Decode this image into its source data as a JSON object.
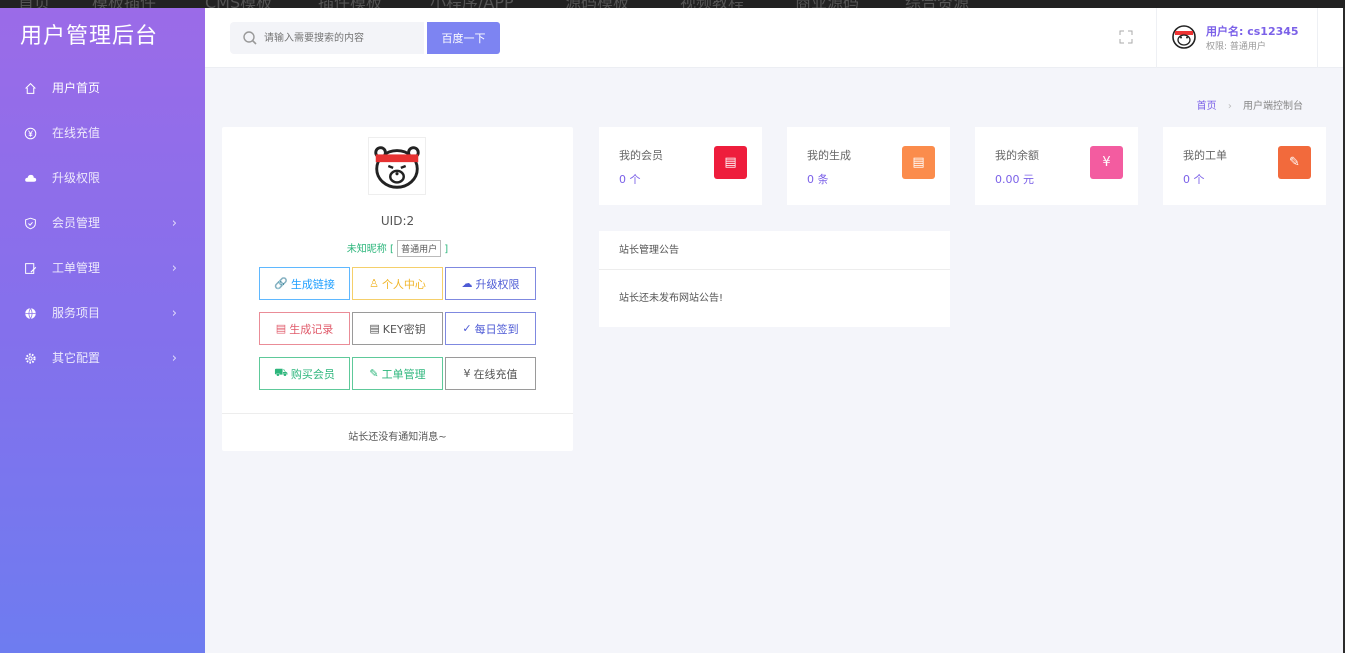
{
  "app": {
    "title": "用户管理后台"
  },
  "top_strip": {
    "items": [
      "首页",
      "模板插件",
      "CMS模板",
      "插件模板",
      "小程序/APP",
      "源码模板",
      "视频教程",
      "商业源码",
      "综合资源"
    ]
  },
  "sidebar": {
    "items": [
      {
        "label": "用户首页",
        "icon": "home-icon",
        "has_submenu": false
      },
      {
        "label": "在线充值",
        "icon": "yuan-icon",
        "has_submenu": false
      },
      {
        "label": "升级权限",
        "icon": "cloud-icon",
        "has_submenu": false
      },
      {
        "label": "会员管理",
        "icon": "shield-icon",
        "has_submenu": true
      },
      {
        "label": "工单管理",
        "icon": "edit-icon",
        "has_submenu": true
      },
      {
        "label": "服务项目",
        "icon": "globe-icon",
        "has_submenu": true
      },
      {
        "label": "其它配置",
        "icon": "gear-icon",
        "has_submenu": true
      }
    ],
    "chevron": "›"
  },
  "header": {
    "search_placeholder": "请输入需要搜索的内容",
    "search_button": "百度一下",
    "user_name": "用户名: cs12345",
    "user_role": "权限: 普通用户"
  },
  "breadcrumb": {
    "home": "首页",
    "separator": "›",
    "current": "用户端控制台"
  },
  "profile": {
    "uid": "UID:2",
    "nickname": "未知昵称",
    "tag": "普通用户",
    "bracket_open": "[",
    "bracket_close": "]",
    "buttons": [
      {
        "label": "生成链接",
        "icon": "link-icon",
        "color": "#1e9fff"
      },
      {
        "label": "个人中心",
        "icon": "user-icon",
        "color": "#f5c040"
      },
      {
        "label": "升级权限",
        "icon": "cloud-icon",
        "color": "#4e5bd5"
      },
      {
        "label": "生成记录",
        "icon": "file-icon",
        "color": "#e05a6a"
      },
      {
        "label": "KEY密钥",
        "icon": "file-icon",
        "color": "#555555"
      },
      {
        "label": "每日签到",
        "icon": "check-circle-icon",
        "color": "#4e5bd5"
      },
      {
        "label": "购买会员",
        "icon": "cart-icon",
        "color": "#2db67c"
      },
      {
        "label": "工单管理",
        "icon": "edit-icon",
        "color": "#2db67c"
      },
      {
        "label": "在线充值",
        "icon": "yuan-icon",
        "color": "#555555"
      }
    ],
    "notice": "站长还没有通知消息~"
  },
  "stats": [
    {
      "label": "我的会员",
      "value": "0 个",
      "icon": "doc-icon",
      "color": "#ee1d3c"
    },
    {
      "label": "我的生成",
      "value": "0 条",
      "icon": "doc-icon",
      "color": "#fb8c4c"
    },
    {
      "label": "我的余额",
      "value": "0.00 元",
      "icon": "yuan-icon",
      "color": "#f35ca0"
    },
    {
      "label": "我的工单",
      "value": "0 个",
      "icon": "edit-icon",
      "color": "#f26a3c"
    }
  ],
  "announcement": {
    "title": "站长管理公告",
    "body": "站长还未发布网站公告!"
  },
  "colors": {
    "accent": "#7b61e8",
    "sidebar_top": "#9b6be8",
    "sidebar_bottom": "#6e7cf0",
    "search_button": "#7d84f2"
  }
}
